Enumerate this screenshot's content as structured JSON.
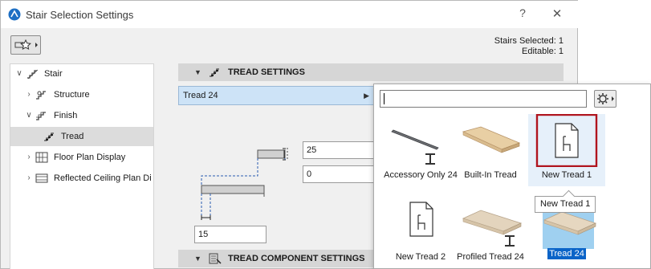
{
  "window": {
    "title": "Stair Selection Settings",
    "help_label": "?",
    "close_label": "✕"
  },
  "header": {
    "stairs_selected": "Stairs Selected: 1",
    "editable": "Editable: 1"
  },
  "tree": {
    "items": [
      {
        "label": "Stair",
        "chevron": "∨",
        "icon": "stair-icon"
      },
      {
        "label": "Structure",
        "chevron": "›",
        "icon": "structure-icon"
      },
      {
        "label": "Finish",
        "chevron": "∨",
        "icon": "finish-icon"
      },
      {
        "label": "Tread",
        "chevron": "",
        "icon": "tread-icon"
      },
      {
        "label": "Floor Plan Display",
        "chevron": "›",
        "icon": "floor-plan-icon"
      },
      {
        "label": "Reflected Ceiling Plan Di",
        "chevron": "›",
        "icon": "ceiling-plan-icon"
      }
    ]
  },
  "sections": {
    "tread_settings": "TREAD SETTINGS",
    "tread_component_settings": "TREAD COMPONENT SETTINGS"
  },
  "tread_select": {
    "value": "Tread 24"
  },
  "fields": {
    "thickness": "25",
    "offset": "0",
    "nosing": "15"
  },
  "popup": {
    "search_value": "",
    "tiles": [
      {
        "label": "Accessory Only 24",
        "icon": "accessory-object-icon"
      },
      {
        "label": "Built-In Tread",
        "icon": "built-in-tread-icon"
      },
      {
        "label": "New Tread 1",
        "icon": "new-object-icon"
      },
      {
        "label": "New Tread 2",
        "icon": "new-object-icon"
      },
      {
        "label": "Profiled Tread 24",
        "icon": "profiled-tread-icon"
      },
      {
        "label": "Tread 24",
        "icon": "tread-board-icon"
      }
    ],
    "tooltip": "New Tread 1"
  },
  "colors": {
    "selection_blue": "#0a64c8",
    "highlight_red": "#b0141e",
    "select_bg": "#cde3f7"
  }
}
